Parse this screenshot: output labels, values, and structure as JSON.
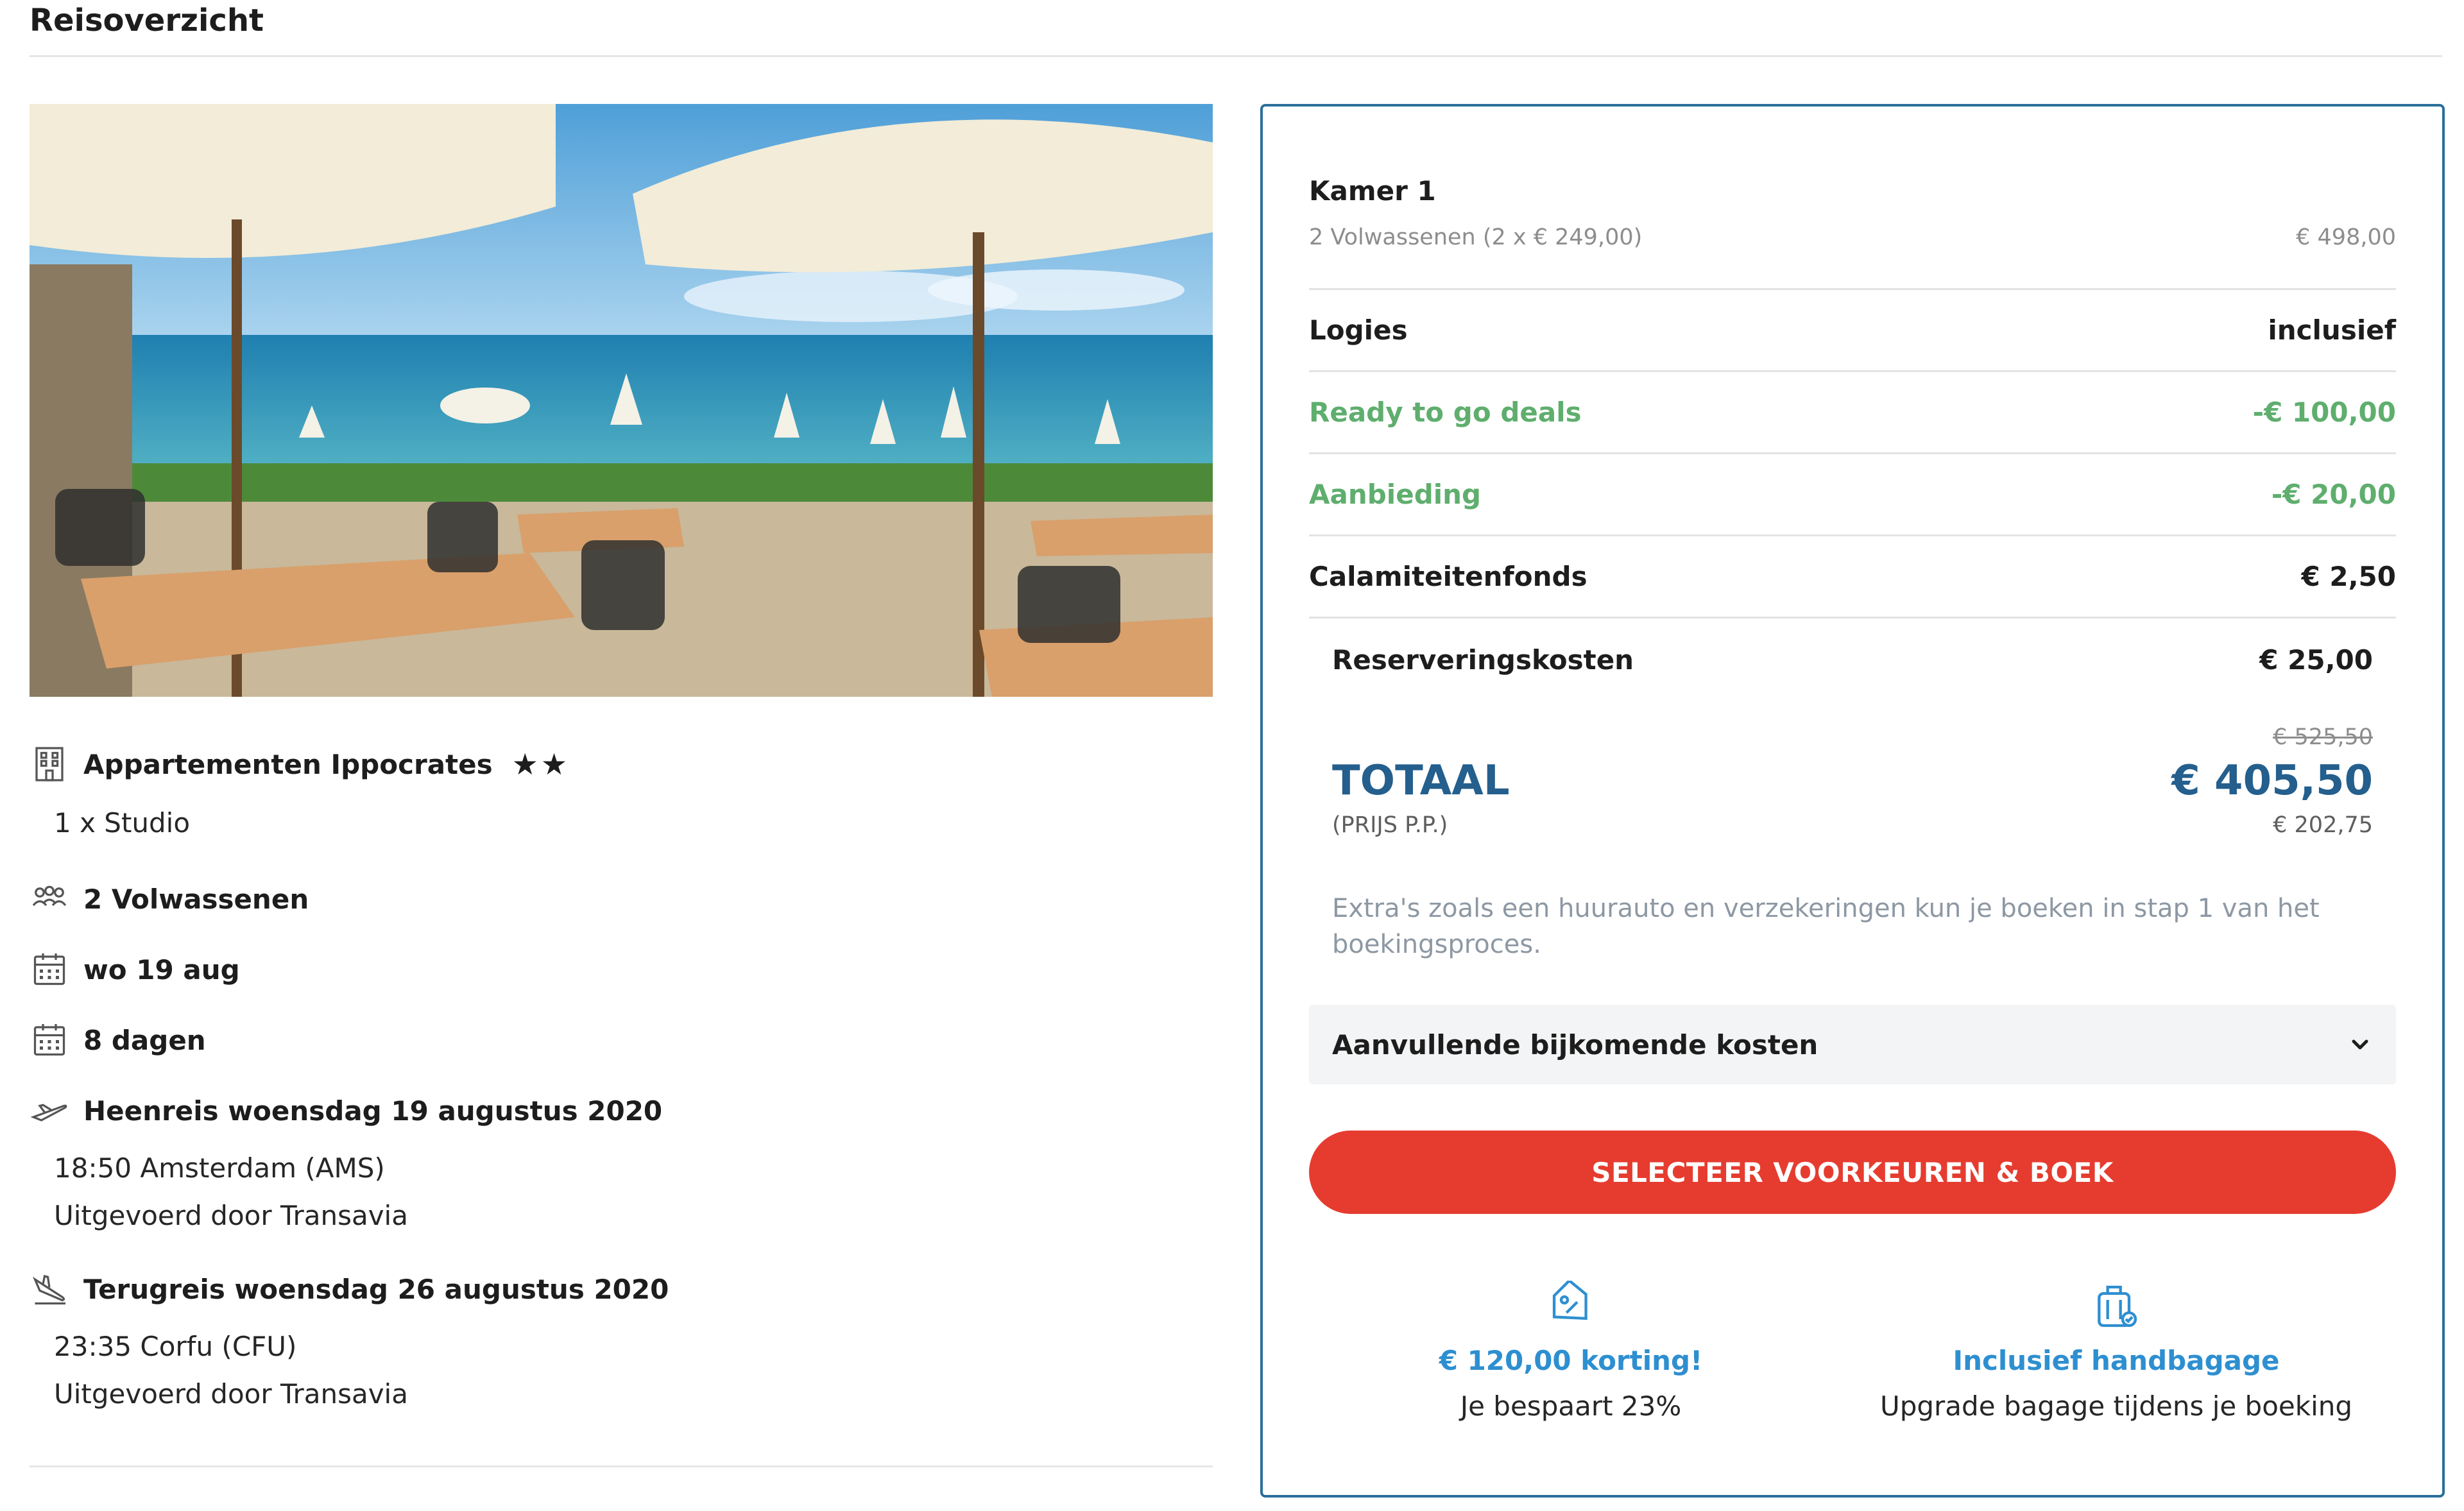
{
  "page": {
    "title": "Reisoverzicht"
  },
  "hotel": {
    "name": "Appartementen Ippocrates",
    "stars": "★★",
    "room": "1 x Studio",
    "icon": "building-icon"
  },
  "travelers": {
    "label": "2 Volwassenen",
    "icon": "people-icon"
  },
  "departure_date": {
    "label": "wo 19 aug",
    "icon": "calendar-icon"
  },
  "duration": {
    "label": "8 dagen",
    "icon": "calendar-icon"
  },
  "outbound": {
    "title": "Heenreis woensdag 19 augustus 2020",
    "time_place": "18:50 Amsterdam (AMS)",
    "operator": "Uitgevoerd door Transavia",
    "icon": "plane-takeoff-icon"
  },
  "return": {
    "title": "Terugreis woensdag 26 augustus 2020",
    "time_place": "23:35 Corfu (CFU)",
    "operator": "Uitgevoerd door Transavia",
    "icon": "plane-landing-icon"
  },
  "summary": {
    "room": {
      "label": "Kamer 1",
      "sub_label": "2 Volwassenen (2 x € 249,00)",
      "sub_value": "€ 498,00"
    },
    "logies": {
      "label": "Logies",
      "value": "inclusief"
    },
    "deals": {
      "label": "Ready to go deals",
      "value": "-€ 100,00"
    },
    "offer": {
      "label": "Aanbieding",
      "value": "-€ 20,00"
    },
    "fund": {
      "label": "Calamiteitenfonds",
      "value": "€ 2,50"
    },
    "booking_fee": {
      "label": "Reserveringskosten",
      "value": "€ 25,00"
    },
    "total": {
      "old_price": "€ 525,50",
      "label": "TOTAAL",
      "value": "€ 405,50",
      "pp_label": "(PRIJS P.P.)",
      "pp_value": "€ 202,75"
    },
    "extras_note": "Extra's zoals een huurauto en verzekeringen kun je boeken in stap 1 van het boekingsproces.",
    "additional_costs": {
      "label": "Aanvullende bijkomende kosten",
      "icon": "chevron-down-icon"
    },
    "cta": {
      "label": "SELECTEER VOORKEUREN & BOEK"
    },
    "perks": [
      {
        "title": "€ 120,00 korting!",
        "subtitle": "Je bespaart 23%",
        "icon": "discount-tag-icon"
      },
      {
        "title": "Inclusief handbagage",
        "subtitle": "Upgrade bagage tijdens je boeking",
        "icon": "luggage-icon"
      }
    ]
  },
  "colors": {
    "accent_blue": "#245f8d",
    "link_blue": "#2e8fd0",
    "green": "#5fae6e",
    "cta_red": "#e63c30",
    "box_border": "#2a6f9c"
  }
}
